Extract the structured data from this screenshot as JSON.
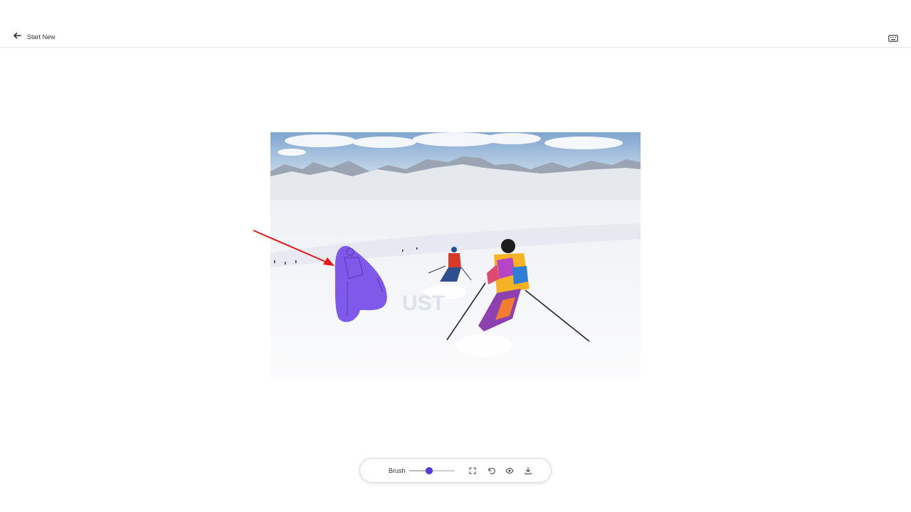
{
  "header": {
    "back_label": "Start New",
    "back_icon": "arrow-left-icon",
    "right_icon": "keyboard-icon"
  },
  "canvas": {
    "image_description": "",
    "mask_color": "#6a3ee8",
    "annotation_arrow_color": "#e0191b",
    "watermark_text": "UST"
  },
  "toolbar": {
    "brush_label": "Brush",
    "brush_size_fraction": 0.44,
    "accent_color": "#5b3ee0",
    "icons": [
      "fullscreen-icon",
      "undo-icon",
      "eye-icon",
      "download-icon"
    ]
  }
}
